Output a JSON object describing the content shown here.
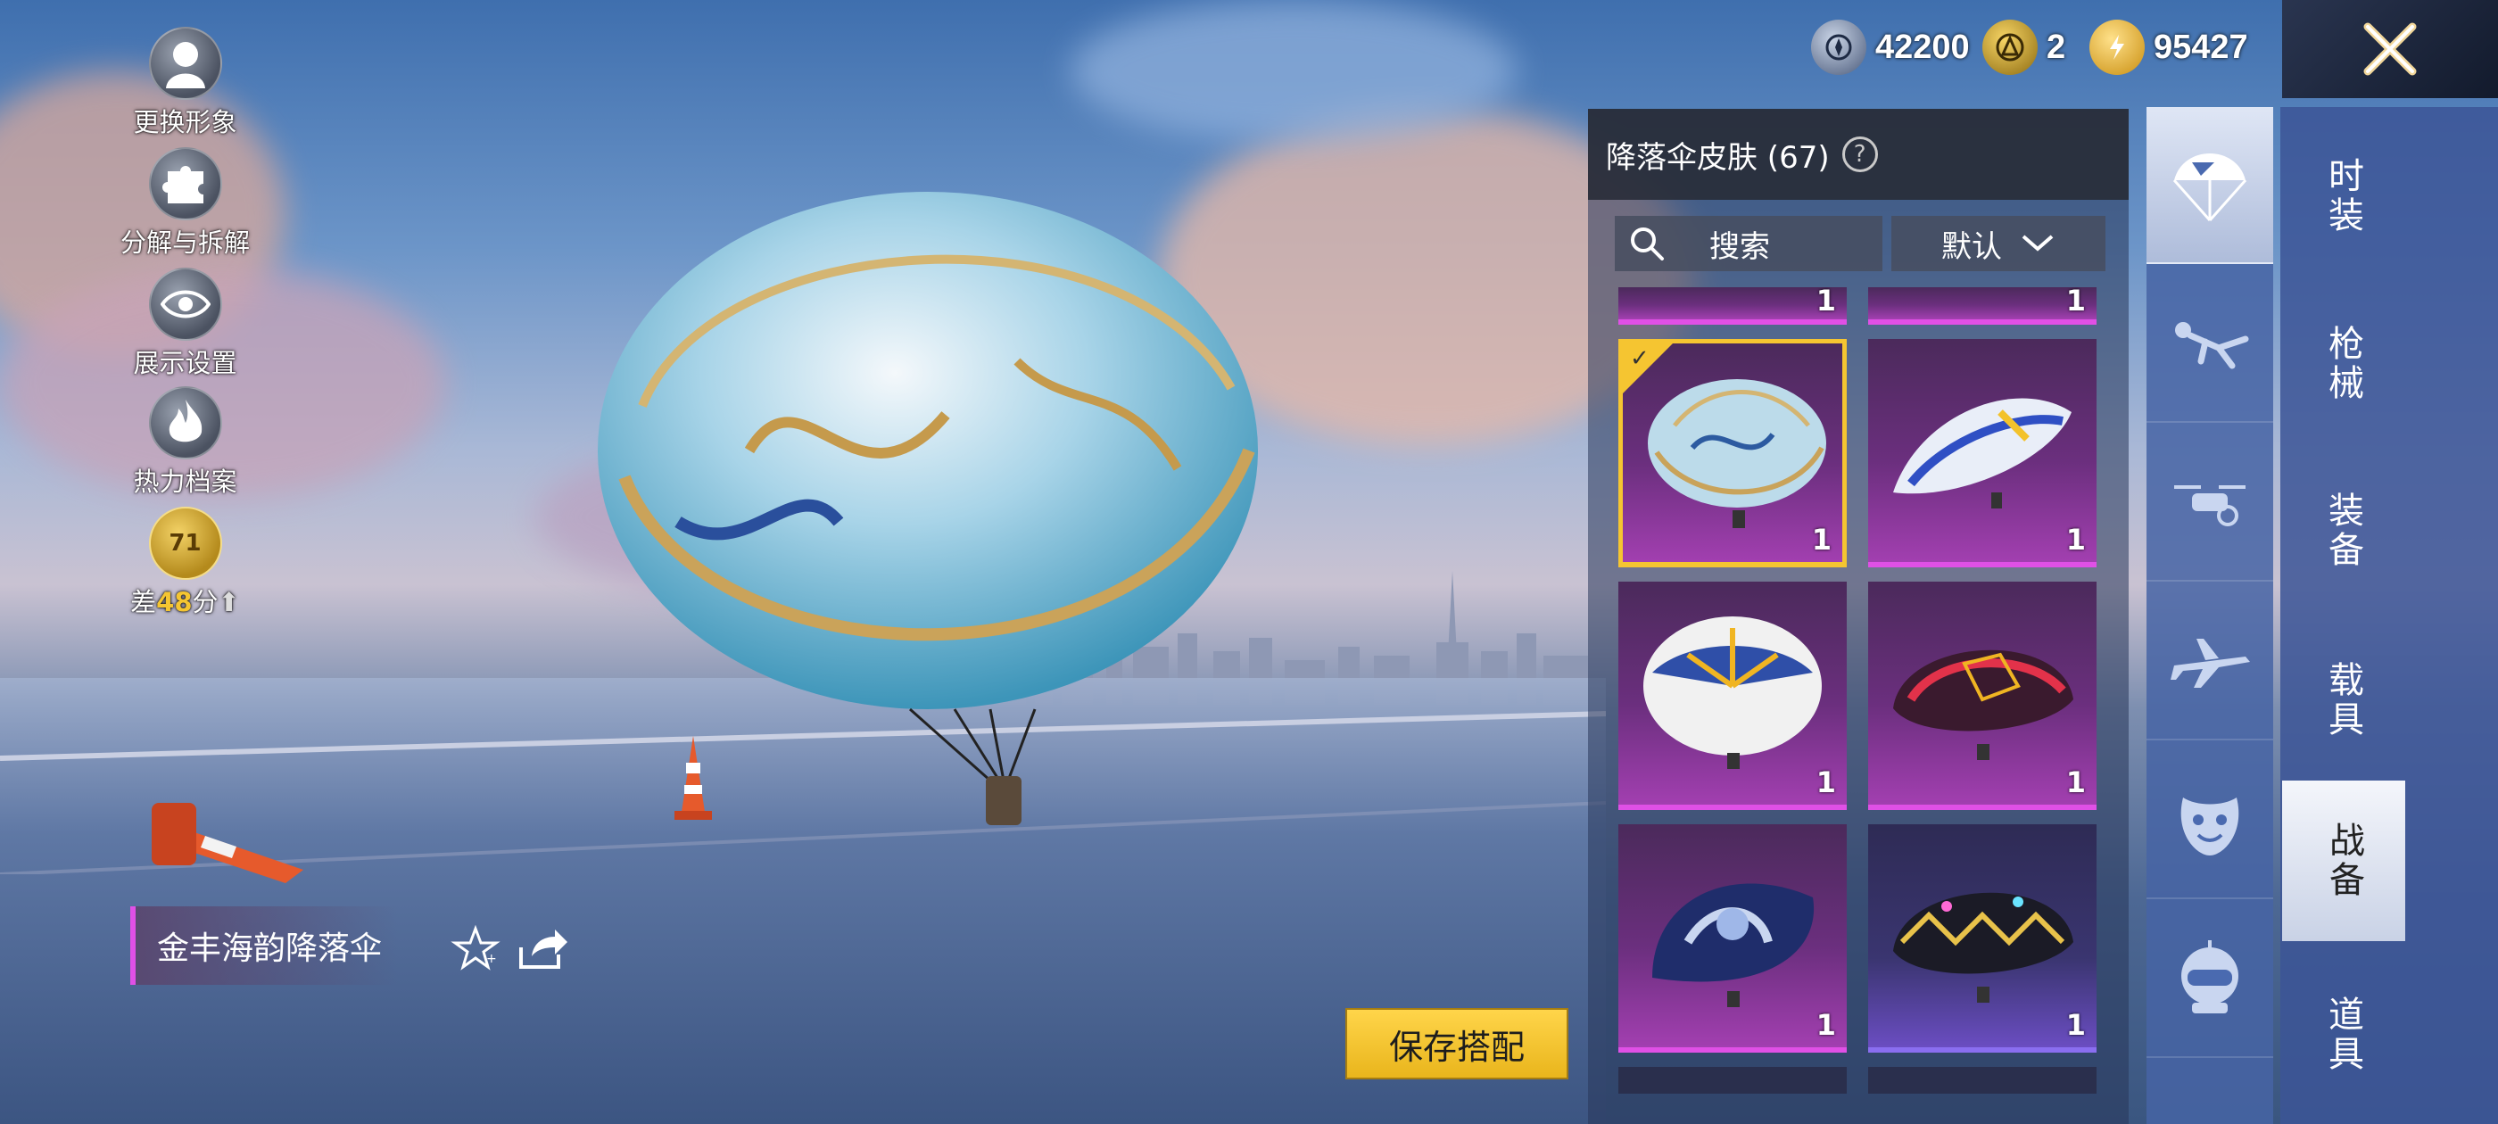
{
  "currency": {
    "silver": "42200",
    "tokens": "2",
    "gold": "95427"
  },
  "side_menu": [
    {
      "label": "更换形象",
      "icon": "avatar-icon"
    },
    {
      "label": "分解与拆解",
      "icon": "puzzle-icon"
    },
    {
      "label": "展示设置",
      "icon": "eye-icon"
    },
    {
      "label": "热力档案",
      "icon": "flame-icon"
    }
  ],
  "score_badge": {
    "level": "71",
    "prefix": "差",
    "value": "48",
    "suffix": "分"
  },
  "inventory": {
    "title": "降落伞皮肤 (67)",
    "search_label": "搜索",
    "sort_label": "默认",
    "items": [
      {
        "count": "1",
        "selected": true,
        "name": "gold-marble-parachute"
      },
      {
        "count": "1",
        "selected": false,
        "name": "blue-white-parachute"
      },
      {
        "count": "1",
        "selected": false,
        "name": "blue-gold-dome-parachute"
      },
      {
        "count": "1",
        "selected": false,
        "name": "red-black-parachute"
      },
      {
        "count": "1",
        "selected": false,
        "name": "cosmic-navy-parachute"
      },
      {
        "count": "1",
        "selected": false,
        "name": "dark-gold-parachute"
      }
    ],
    "partial_row_counts": [
      "1",
      "1"
    ]
  },
  "category_tabs": [
    "时装",
    "枪械",
    "装备",
    "载具",
    "战备",
    "道具"
  ],
  "active_category": "战备",
  "subcategory_icons": [
    "parachute-icon",
    "skydiver-icon",
    "drone-icon",
    "airplane-icon",
    "emote-face-icon",
    "robot-icon"
  ],
  "item_name": "金丰海韵降落伞",
  "save_button": "保存搭配",
  "colors": {
    "accent_gold": "#f5c531",
    "rarity_purple": "#e050e6"
  }
}
